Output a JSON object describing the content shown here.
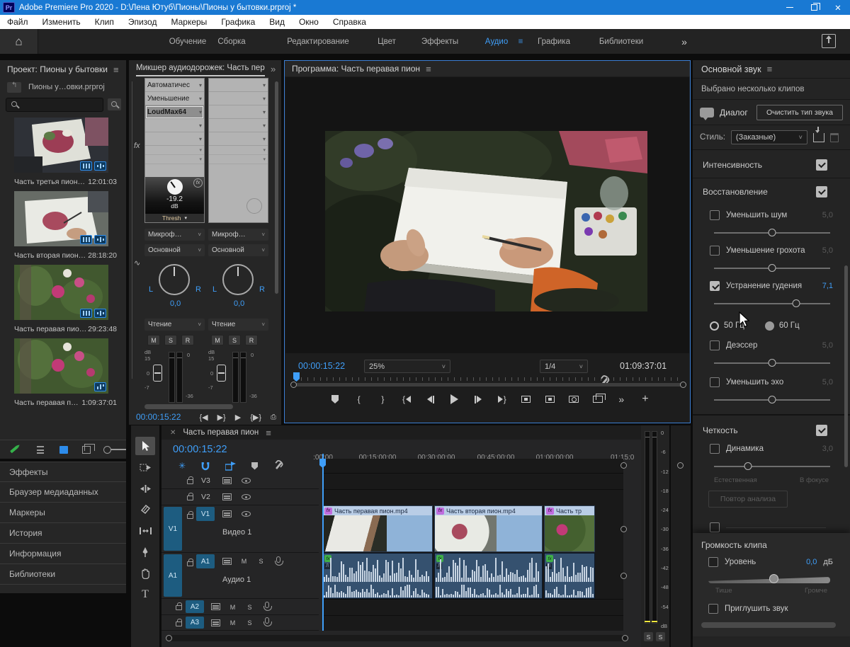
{
  "window": {
    "app_icon": "Pr",
    "title": "Adobe Premiere Pro 2020 - D:\\Лена Ютуб\\Пионы\\Пионы у бытовки.prproj *"
  },
  "menu": {
    "items": [
      "Файл",
      "Изменить",
      "Клип",
      "Эпизод",
      "Маркеры",
      "Графика",
      "Вид",
      "Окно",
      "Справка"
    ]
  },
  "workspaces": {
    "items": [
      "Обучение",
      "Сборка",
      "Редактирование",
      "Цвет",
      "Эффекты",
      "Аудио",
      "Графика",
      "Библиотеки"
    ],
    "active": "Аудио",
    "overflow": "»"
  },
  "icons": {
    "panel_menu": "≡",
    "overflow": "»",
    "close": "✕",
    "dropdown": "˅",
    "play": "▶",
    "brace_open": "{",
    "brace_close": "}",
    "plus": "+",
    "home": "⌂",
    "cross": "✕"
  },
  "project": {
    "title": "Проект: Пионы у бытовки",
    "file_label": "Пионы у…овки.prproj",
    "clips": [
      {
        "name": "Часть третья пион…",
        "duration": "12:01:03"
      },
      {
        "name": "Часть вторая пион…",
        "duration": "28:18:20"
      },
      {
        "name": "Часть перавая пио…",
        "duration": "29:23:48"
      },
      {
        "name": "Часть перавая п…",
        "duration": "1:09:37:01"
      }
    ],
    "bottom_tabs": [
      "Эффекты",
      "Браузер медиаданных",
      "Маркеры",
      "История",
      "Информация",
      "Библиотеки"
    ]
  },
  "mixer": {
    "title": "Микшер аудиодорожек: Часть пер",
    "effects": [
      "Автоматичес",
      "Уменьшение",
      "LoudMax64"
    ],
    "knob": {
      "value": "-19.2",
      "unit": "dB",
      "param": "Thresh"
    },
    "input": "Микроф…",
    "output": "Основной",
    "pan": {
      "left": "L",
      "right": "R",
      "value": "0,0"
    },
    "automation": "Чтение",
    "buttons": [
      "M",
      "S",
      "R"
    ],
    "meter": {
      "unit": "dB",
      "m15": "15",
      "m0": "0",
      "m7": "-7",
      "r0": "0",
      "r36": "-36"
    },
    "timecode": "00:00:15:22",
    "fx_label": "fx"
  },
  "program": {
    "title": "Программа: Часть перавая пион",
    "timecode": "00:00:15:22",
    "zoom_level": "25%",
    "playback_resolution": "1/4",
    "duration": "01:09:37:01"
  },
  "essential_sound": {
    "title": "Основной звук",
    "status": "Выбрано несколько клипов",
    "audio_type": "Диалог",
    "clear_button": "Очистить тип звука",
    "preset_label": "Стиль:",
    "preset_value": "(Заказные)",
    "loudness_label": "Интенсивность",
    "repair_label": "Восстановление",
    "sliders": [
      {
        "label": "Уменьшить шум",
        "value": "5,0"
      },
      {
        "label": "Уменьшение грохота",
        "value": "5,0"
      },
      {
        "label": "Устранение гудения",
        "value": "7,1"
      },
      {
        "label": "Деэссер",
        "value": "5,0"
      },
      {
        "label": "Уменьшить эхо",
        "value": "5,0"
      }
    ],
    "hum_50": "50 Гц",
    "hum_60": "60 Гц",
    "clarity_label": "Четкость",
    "dynamics": {
      "label": "Динамика",
      "value": "3,0",
      "min_label": "Естественная",
      "max_label": "В фокусе"
    },
    "reanalyze_button": "Повтор анализа",
    "clip_volume": {
      "section": "Громкость клипа",
      "level_label": "Уровень",
      "level_value": "0,0",
      "level_unit": "дБ",
      "min_label": "Тише",
      "max_label": "Громче",
      "mute_label": "Приглушить звук"
    }
  },
  "timeline": {
    "tab": "Часть перавая пион",
    "timecode": "00:00:15:22",
    "ruler": [
      ":00:00",
      "00:15:00:00",
      "00:30:00:00",
      "00:45:00:00",
      "01:00:00:00",
      "01:15:0"
    ],
    "video_tracks": [
      "V3",
      "V2",
      "V1"
    ],
    "video_track_name": "Видео 1",
    "audio_tracks": [
      "A1",
      "A2",
      "A3"
    ],
    "audio_track_name": "Аудио 1",
    "clips": [
      {
        "name": "Часть перавая пион.mp4"
      },
      {
        "name": "Часть вторая пион.mp4"
      },
      {
        "name": "Часть тр"
      }
    ],
    "meter_scale": [
      "0",
      "-6",
      "-12",
      "-18",
      "-24",
      "-30",
      "-36",
      "-42",
      "-48",
      "-54",
      "dB"
    ],
    "solo": "S",
    "mute": "M",
    "tool_type_label": "T"
  }
}
